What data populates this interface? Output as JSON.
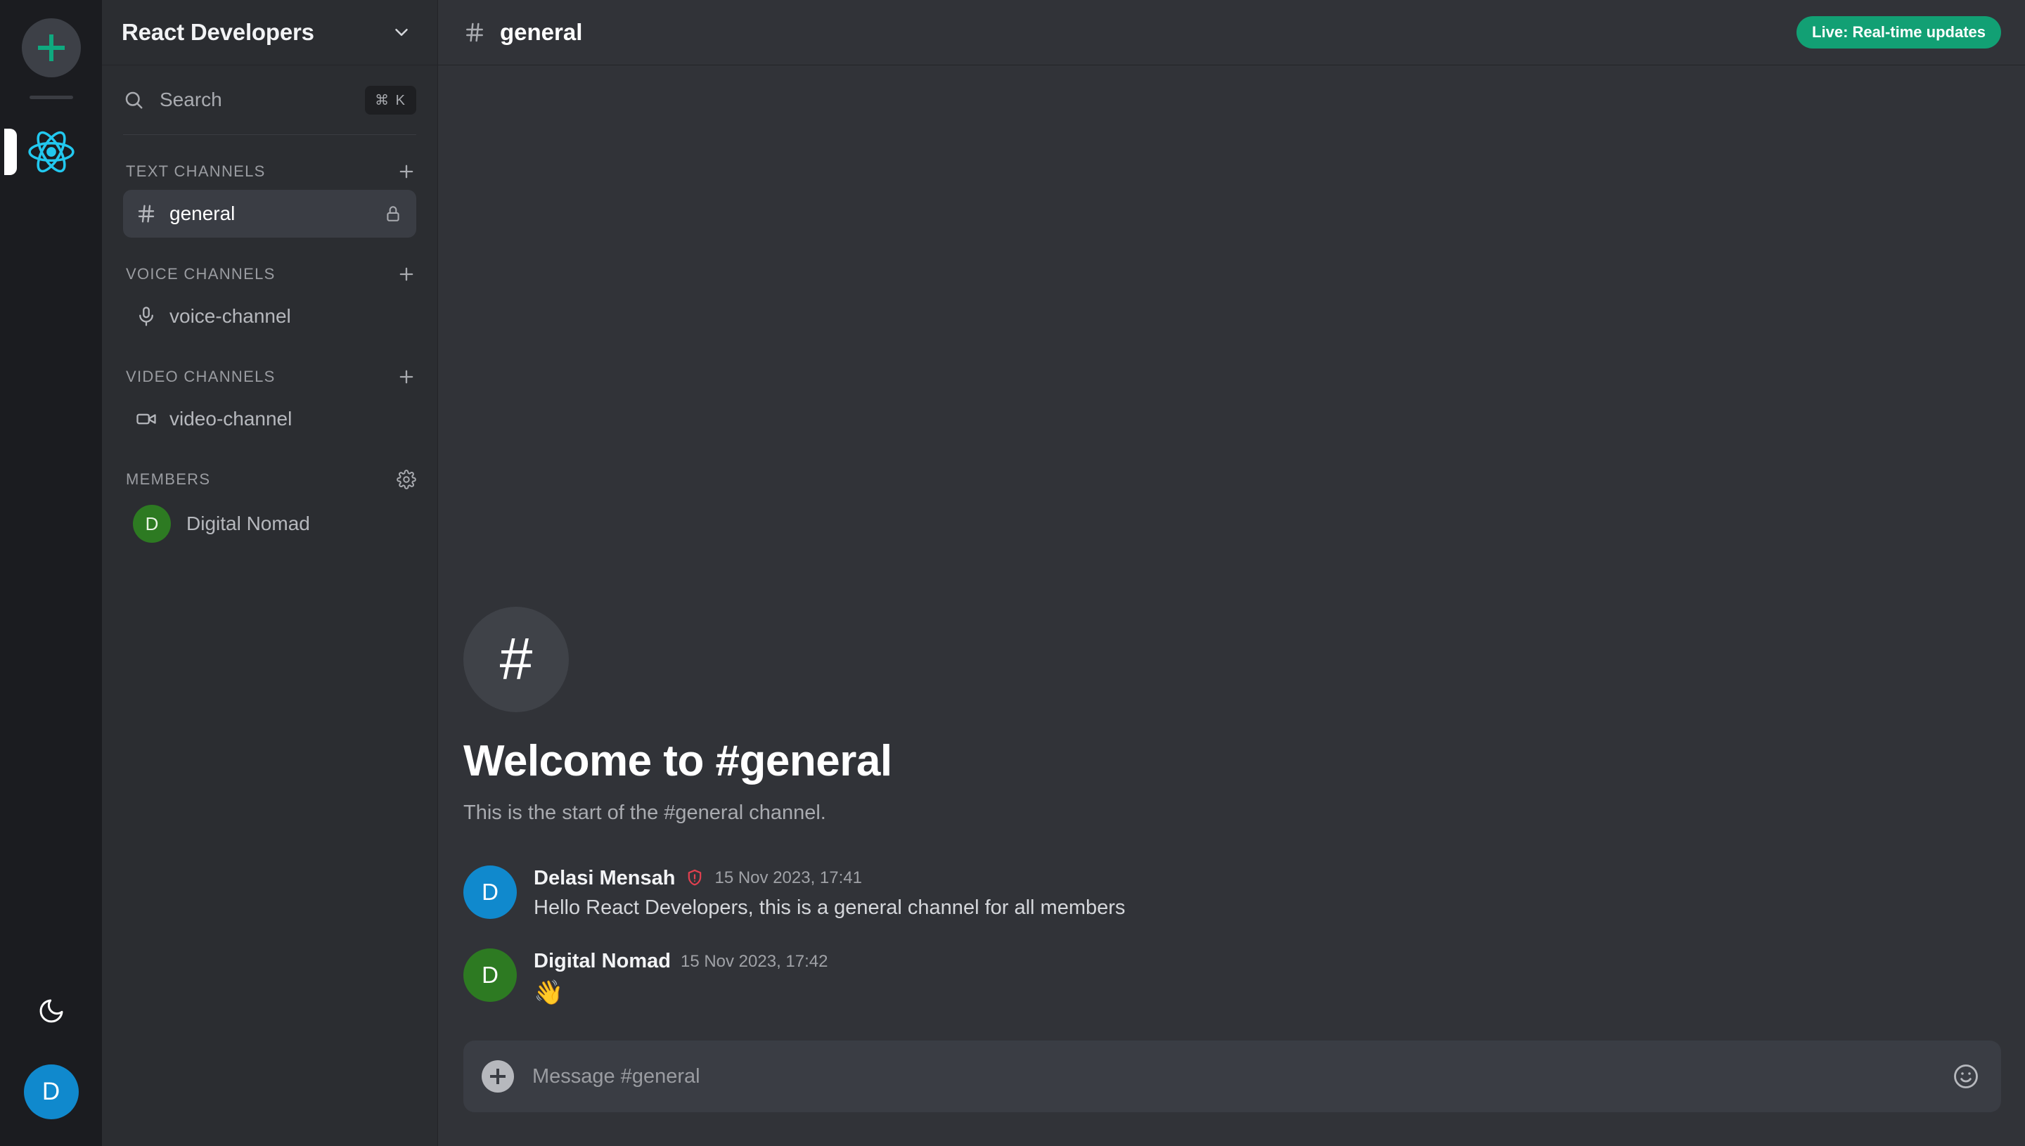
{
  "rail": {
    "add_server_label": "+",
    "server_icon_name": "react-logo",
    "theme_toggle_icon": "moon-icon",
    "user_avatar_initial": "D",
    "user_avatar_color": "#1089cd",
    "active_indicator": true
  },
  "sidebar": {
    "server_name": "React Developers",
    "chevron_icon": "chevron-down-icon",
    "search": {
      "placeholder": "Search",
      "icon": "search-icon",
      "shortcut": "⌘ K"
    },
    "sections": [
      {
        "title": "TEXT CHANNELS",
        "action_icon": "plus-icon",
        "items": [
          {
            "name": "general",
            "icon": "hash-icon",
            "active": true,
            "trailing_icon": "lock-icon"
          }
        ]
      },
      {
        "title": "VOICE CHANNELS",
        "action_icon": "plus-icon",
        "items": [
          {
            "name": "voice-channel",
            "icon": "microphone-icon",
            "active": false,
            "trailing_icon": null
          }
        ]
      },
      {
        "title": "VIDEO CHANNELS",
        "action_icon": "plus-icon",
        "items": [
          {
            "name": "video-channel",
            "icon": "video-camera-icon",
            "active": false,
            "trailing_icon": null
          }
        ]
      }
    ],
    "members_section": {
      "title": "MEMBERS",
      "action_icon": "gear-icon",
      "members": [
        {
          "name": "Digital Nomad",
          "initial": "D",
          "color": "#2d7a22"
        }
      ]
    }
  },
  "main": {
    "header": {
      "hash_icon": "hash-icon",
      "channel_name": "general",
      "live_badge": "Live: Real-time updates",
      "live_badge_color": "#12a074"
    },
    "welcome": {
      "icon": "#",
      "title": "Welcome to #general",
      "subtitle": "This is the start of the #general channel."
    },
    "messages": [
      {
        "author": "Delasi Mensah",
        "initial": "D",
        "avatar_color": "#1089cd",
        "badge_icon": "shield-alert-icon",
        "badge_color": "#e0404f",
        "timestamp": "15 Nov 2023, 17:41",
        "text": "Hello React Developers, this is a general channel for all members",
        "is_emoji": false
      },
      {
        "author": "Digital Nomad",
        "initial": "D",
        "avatar_color": "#2d7a22",
        "badge_icon": null,
        "badge_color": null,
        "timestamp": "15 Nov 2023, 17:42",
        "text": "👋",
        "is_emoji": true
      }
    ],
    "composer": {
      "add_icon": "plus-circle-icon",
      "placeholder": "Message #general",
      "value": "",
      "emoji_icon": "smiley-icon"
    }
  }
}
